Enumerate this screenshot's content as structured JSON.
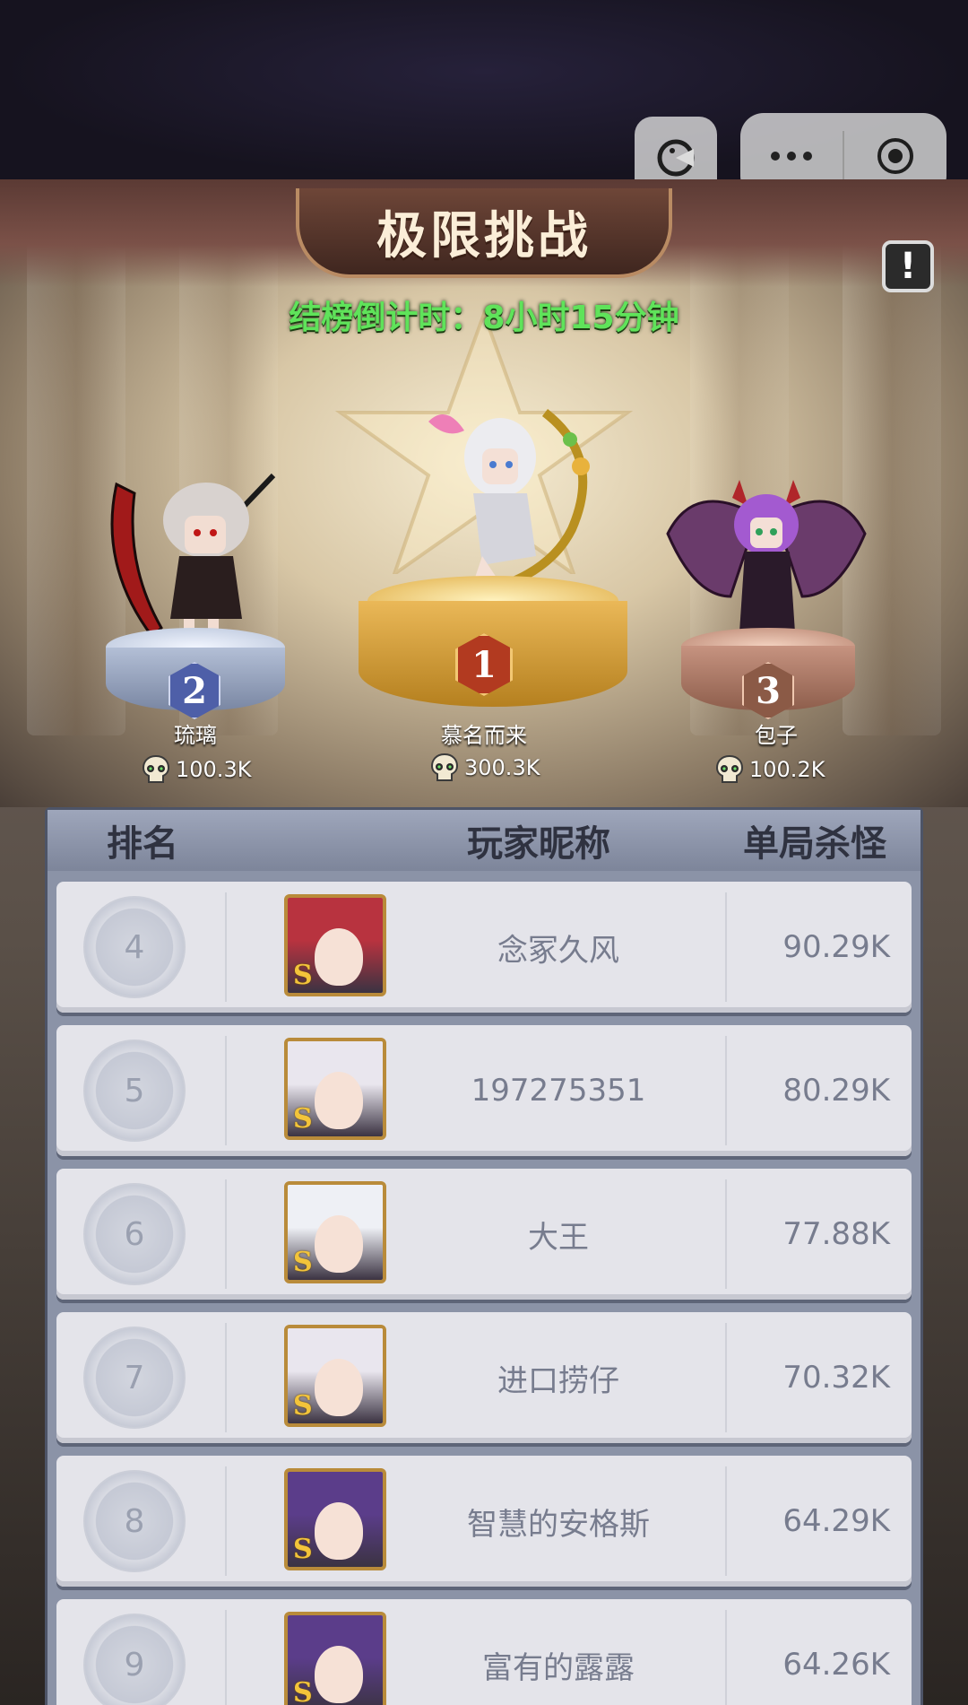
{
  "header": {
    "title": "极限挑战",
    "countdown": "结榜倒计时：8小时15分钟",
    "help_label": "!"
  },
  "capsule": {
    "game_icon": "pacman-icon",
    "more_icon": "more-dots-icon",
    "close_icon": "target-circle-icon"
  },
  "podium": [
    {
      "rank": "2",
      "name": "琉璃",
      "score": "100.3K",
      "badge_color": "#4e5fa8"
    },
    {
      "rank": "1",
      "name": "慕名而来",
      "score": "300.3K",
      "badge_color": "#b23a20"
    },
    {
      "rank": "3",
      "name": "包子",
      "score": "100.2K",
      "badge_color": "#8b5a46"
    }
  ],
  "table": {
    "headers": {
      "rank": "排名",
      "nickname": "玩家昵称",
      "kills": "单局杀怪"
    },
    "rows": [
      {
        "rank": "4",
        "nickname": "念冢久风",
        "kills": "90.29K",
        "hair": "#b8333f"
      },
      {
        "rank": "5",
        "nickname": "197275351",
        "kills": "80.29K",
        "hair": "#e9e6ee"
      },
      {
        "rank": "6",
        "nickname": "大王",
        "kills": "77.88K",
        "hair": "#eef0f5"
      },
      {
        "rank": "7",
        "nickname": "进口捞仔",
        "kills": "70.32K",
        "hair": "#e9e6ee"
      },
      {
        "rank": "8",
        "nickname": "智慧的安格斯",
        "kills": "64.29K",
        "hair": "#5b3d8a"
      },
      {
        "rank": "9",
        "nickname": "富有的露露",
        "kills": "64.26K",
        "hair": "#5b3d8a"
      }
    ],
    "avatar_badge": "S"
  }
}
